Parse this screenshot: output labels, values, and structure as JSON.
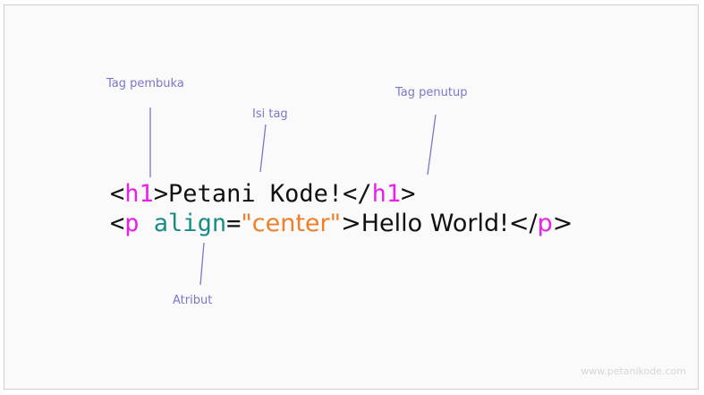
{
  "colors": {
    "text": "#111111",
    "tag": "#e820e8",
    "attribute": "#188c88",
    "value": "#f07f2a",
    "annotation": "#7877c9",
    "watermark": "#d6d6d6"
  },
  "annotations": {
    "opening_tag": "Tag pembuka",
    "tag_content": "Isi tag",
    "closing_tag": "Tag penutup",
    "attribute": "Atribut"
  },
  "code": {
    "line1": {
      "lt1": "<",
      "tag_open": "h1",
      "gt1": ">",
      "content": "Petani Kode!",
      "lt2": "</",
      "tag_close": "h1",
      "gt2": ">"
    },
    "line2": {
      "lt1": "<",
      "tag_open": "p",
      "space": " ",
      "attr_name": "align",
      "equals": "=",
      "attr_value": "\"center\"",
      "gt1": ">",
      "content": "Hello World!",
      "lt2": "</",
      "tag_close": "p",
      "gt2": ">"
    }
  },
  "watermark": "www.petanikode.com"
}
